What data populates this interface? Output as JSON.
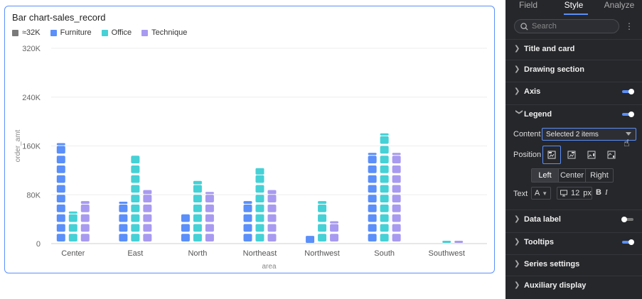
{
  "chart_title": "Bar chart-sales_record",
  "legend": [
    {
      "label": "≈32K",
      "color": "#7a7a7a"
    },
    {
      "label": "Furniture",
      "color": "#5b8ff9"
    },
    {
      "label": "Office",
      "color": "#45d1d6"
    },
    {
      "label": "Technique",
      "color": "#a89af0"
    }
  ],
  "chart_data": {
    "type": "bar",
    "subtype": "pictorial-unit",
    "unit_value": 16000,
    "categories": [
      "Center",
      "East",
      "North",
      "Northeast",
      "Northwest",
      "South",
      "Southwest"
    ],
    "series": [
      {
        "name": "Furniture",
        "color": "#5b8ff9",
        "values": [
          163000,
          65000,
          48000,
          72000,
          15000,
          146000,
          0
        ]
      },
      {
        "name": "Office",
        "color": "#45d1d6",
        "values": [
          50000,
          144000,
          105000,
          126000,
          72000,
          180000,
          5000
        ]
      },
      {
        "name": "Technique",
        "color": "#a89af0",
        "values": [
          72000,
          90000,
          87000,
          90000,
          36000,
          146000,
          6000
        ]
      }
    ],
    "xlabel": "area",
    "ylabel": "order_amt",
    "yticks": [
      0,
      80000,
      160000,
      240000,
      320000
    ],
    "ytick_labels": [
      "0",
      "80K",
      "160K",
      "240K",
      "320K"
    ],
    "ylim": [
      0,
      320000
    ],
    "grid": true,
    "legend_position": "top-left"
  },
  "panel": {
    "tabs": [
      {
        "label": "Field",
        "active": false
      },
      {
        "label": "Style",
        "active": true
      },
      {
        "label": "Analyze",
        "active": false
      }
    ],
    "search_placeholder": "Search",
    "sections": {
      "title_card": "Title and card",
      "drawing_section": "Drawing section",
      "axis": "Axis",
      "legend": "Legend",
      "data_label": "Data label",
      "tooltips": "Tooltips",
      "series_settings": "Series settings",
      "auxiliary_display": "Auxiliary display"
    },
    "toggles": {
      "axis": true,
      "legend": true,
      "data_label": false,
      "tooltips": true
    },
    "legend_settings": {
      "content_label": "Content",
      "content_value": "Selected 2 items",
      "position_label": "Position",
      "align_options": [
        "Left",
        "Center",
        "Right"
      ],
      "align_selected": "Left",
      "text_label": "Text",
      "font_color_glyph": "A",
      "font_size": "12",
      "font_size_unit": "px",
      "bold_glyph": "B",
      "italic_glyph": "I"
    }
  }
}
